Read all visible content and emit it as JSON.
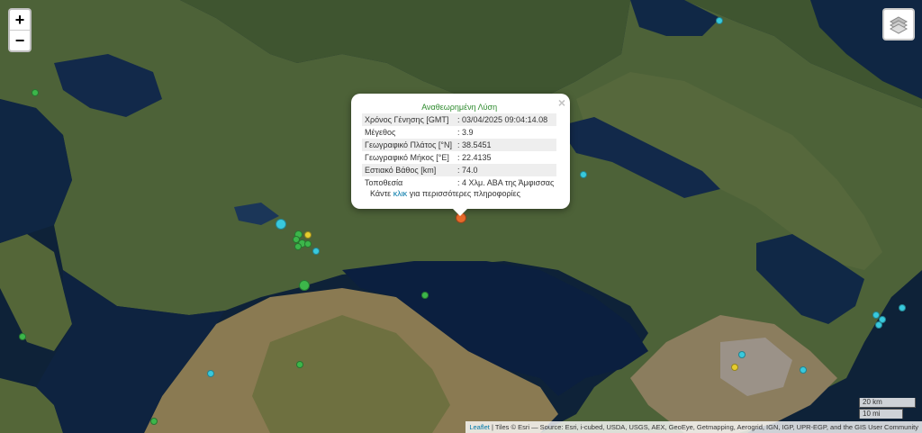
{
  "zoom": {
    "in_label": "+",
    "out_label": "−"
  },
  "layers_icon": "layers-icon",
  "popup": {
    "title": "Αναθεωρημένη Λύση",
    "close_label": "×",
    "rows": [
      {
        "label": "Χρόνος Γένησης [GMT]",
        "value": ": 03/04/2025 09:04:14.08"
      },
      {
        "label": "Μέγεθος",
        "value": ": 3.9"
      },
      {
        "label": "Γεωγραφικό Πλάτος [°N]",
        "value": ": 38.5451"
      },
      {
        "label": "Γεωγραφικό Μήκος [°E]",
        "value": ": 22.4135"
      },
      {
        "label": "Εστιακό Βάθος [km]",
        "value": ": 74.0"
      },
      {
        "label": "Τοποθεσία",
        "value": ": 4 Χλμ. ΑΒΑ της Άμφισσας"
      }
    ],
    "more_prefix": "Κάντε",
    "more_link": "κλικ",
    "more_suffix": "για περισσότερες πληροφορίες"
  },
  "scale": {
    "km": "20 km",
    "mi": "10 mi"
  },
  "attribution": {
    "leaflet": "Leaflet",
    "text": " | Tiles © Esri — Source: Esri, i-cubed, USDA, USGS, AEX, GeoEye, Getmapping, Aerogrid, IGN, IGP, UPR-EGP, and the GIS User Community"
  },
  "colors": {
    "recent": "#e8692a",
    "cyan": "#38c9dd",
    "green": "#3cb64a",
    "yellow": "#e6cc2e"
  }
}
